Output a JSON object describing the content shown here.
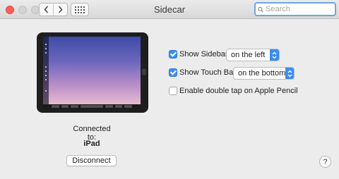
{
  "window": {
    "title": "Sidecar"
  },
  "toolbar": {
    "back_icon": "chevron-left-icon",
    "forward_icon": "chevron-right-icon",
    "show_all_icon": "grid-icon"
  },
  "search": {
    "value": "",
    "placeholder": "Search",
    "icon": "search-icon"
  },
  "options": {
    "show_sidebar": {
      "label": "Show Sidebar",
      "checked": true,
      "popup_value": "on the left"
    },
    "show_touch_bar": {
      "label": "Show Touch Bar",
      "checked": true,
      "popup_value": "on the bottom"
    },
    "double_tap": {
      "label": "Enable double tap on Apple Pencil",
      "checked": false
    }
  },
  "device": {
    "connected_label": "Connected to:",
    "name": "iPad",
    "disconnect_label": "Disconnect"
  },
  "help": {
    "label": "?"
  },
  "colors": {
    "accent": "#3b8df4",
    "close": "#fc5f57",
    "search_ring": "#6fa4e5"
  }
}
